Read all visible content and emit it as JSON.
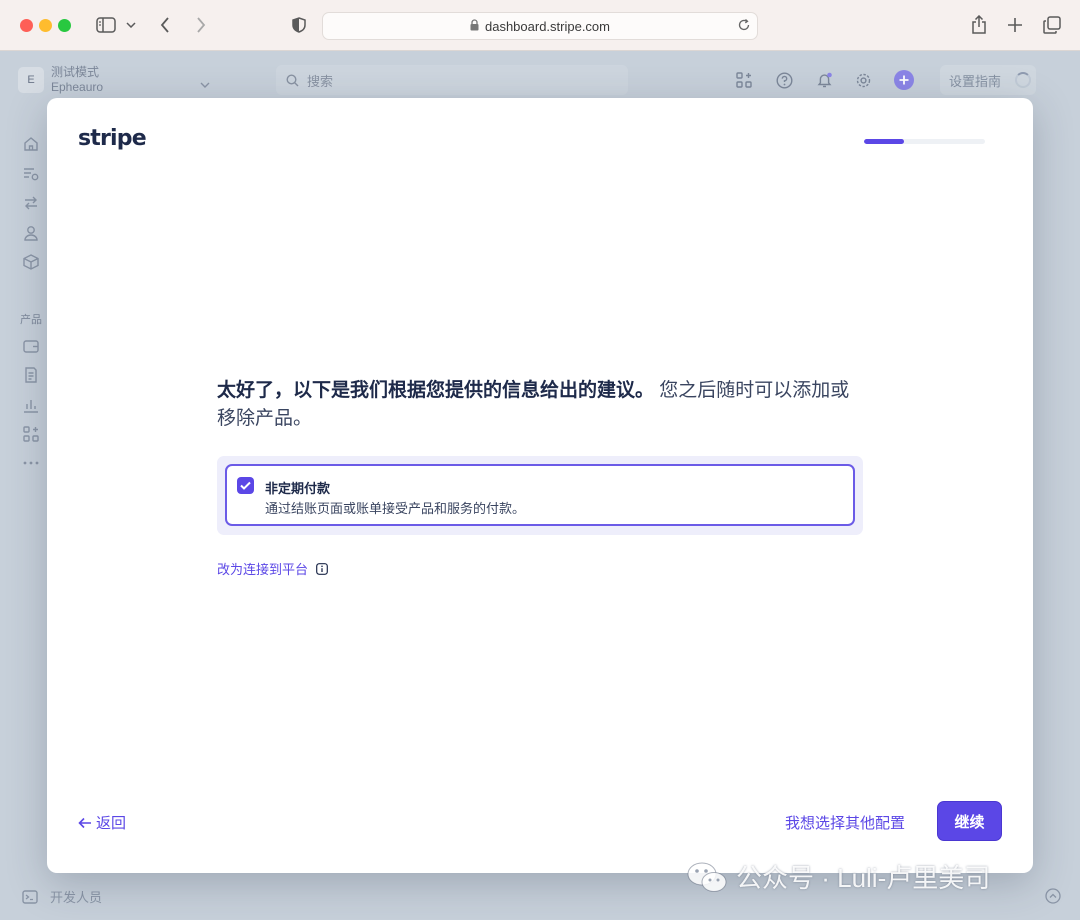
{
  "browser": {
    "url": "dashboard.stripe.com"
  },
  "dashboard": {
    "account_initial": "E",
    "account_mode": "测试模式",
    "account_name": "Epheauro",
    "search_placeholder": "搜索",
    "setup_guide": "设置指南",
    "products_section": "产品",
    "developers": "开发人员"
  },
  "modal": {
    "logo": "stripe",
    "progress_fraction": 0.33,
    "heading_bold": "太好了，以下是我们根据您提供的信息给出的建议。",
    "heading_rest": "您之后随时可以添加或移除产品。",
    "option": {
      "title": "非定期付款",
      "description": "通过结账页面或账单接受产品和服务的付款。",
      "checked": true
    },
    "platform_link": "改为连接到平台",
    "back_label": "返回",
    "other_config_label": "我想选择其他配置",
    "continue_label": "继续"
  },
  "watermark": {
    "text": "公众号 · Luli-卢里美司"
  },
  "colors": {
    "accent": "#5b47e6",
    "option_bg": "#eeeefb"
  }
}
